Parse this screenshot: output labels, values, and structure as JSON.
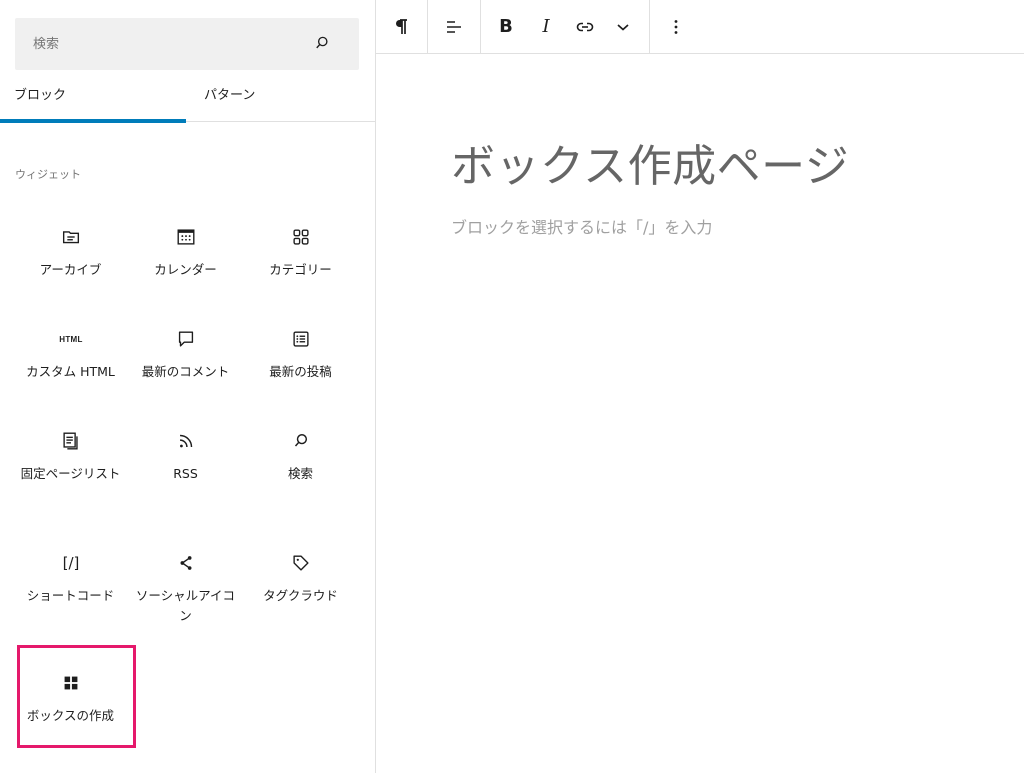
{
  "search": {
    "placeholder": "検索"
  },
  "tabs": [
    {
      "label": "ブロック"
    },
    {
      "label": "パターン"
    }
  ],
  "group": {
    "title": "ウィジェット"
  },
  "blocks": [
    {
      "label": "アーカイブ",
      "icon": "archive-icon"
    },
    {
      "label": "カレンダー",
      "icon": "calendar-icon"
    },
    {
      "label": "カテゴリー",
      "icon": "categories-icon"
    },
    {
      "label": "カスタム HTML",
      "icon": "html-icon",
      "icon_text": "HTML"
    },
    {
      "label": "最新のコメント",
      "icon": "comment-icon"
    },
    {
      "label": "最新の投稿",
      "icon": "post-list-icon"
    },
    {
      "label": "固定ページリスト",
      "icon": "pages-icon"
    },
    {
      "label": "RSS",
      "icon": "rss-icon"
    },
    {
      "label": "検索",
      "icon": "search-icon"
    },
    {
      "label": "ショートコード",
      "icon": "shortcode-icon",
      "icon_text": "[/]"
    },
    {
      "label": "ソーシャルアイコン",
      "icon": "share-icon"
    },
    {
      "label": "タグクラウド",
      "icon": "tag-icon"
    },
    {
      "label": "ボックスの作成",
      "icon": "grid-icon"
    }
  ],
  "highlight_color": "#e5186b",
  "accent_color": "#007cba",
  "toolbar": [
    {
      "name": "paragraph",
      "icon": "pilcrow-icon"
    },
    {
      "name": "align",
      "icon": "align-left-icon"
    },
    {
      "name": "bold",
      "icon": "bold-icon",
      "text": "B"
    },
    {
      "name": "italic",
      "icon": "italic-icon",
      "text": "I"
    },
    {
      "name": "link",
      "icon": "link-icon"
    },
    {
      "name": "more",
      "icon": "chevron-down-icon"
    },
    {
      "name": "options",
      "icon": "more-vertical-icon"
    }
  ],
  "editor": {
    "title": "ボックス作成ページ",
    "appender_placeholder": "ブロックを選択するには「/」を入力"
  }
}
